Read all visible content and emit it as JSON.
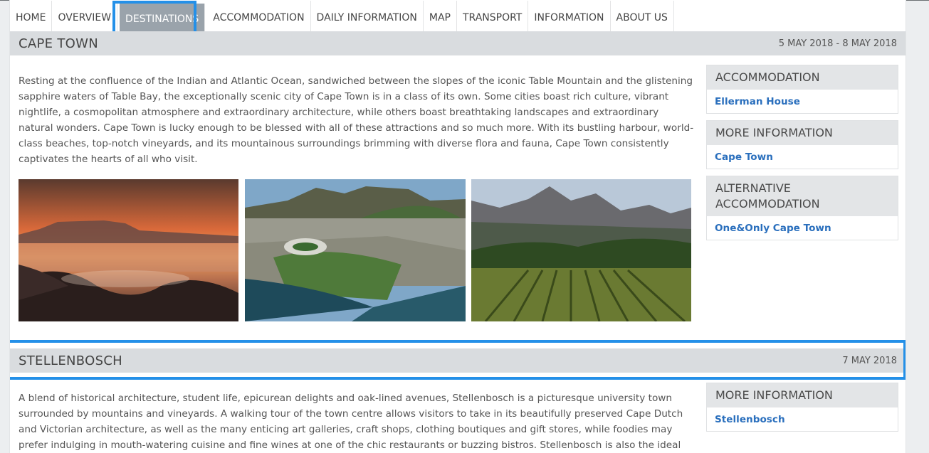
{
  "nav": {
    "items": [
      "HOME",
      "OVERVIEW",
      "DESTINATIONS",
      "ACCOMMODATION",
      "DAILY INFORMATION",
      "MAP",
      "TRANSPORT",
      "INFORMATION",
      "ABOUT US"
    ],
    "active": "DESTINATIONS"
  },
  "cape_town": {
    "title": "CAPE TOWN",
    "dates": "5 MAY 2018 - 8 MAY 2018",
    "description": "Resting at the confluence of the Indian and Atlantic Ocean, sandwiched between the slopes of the iconic Table Mountain and the glistening sapphire waters of Table Bay, the exceptionally scenic city of Cape Town is in a class of its own. Some cities boast rich culture, vibrant nightlife, a cosmopolitan atmosphere and extraordinary architecture, while others boast breathtaking landscapes and extraordinary natural wonders. Cape Town is lucky enough to be blessed with all of these attractions and so much more. With its bustling harbour, world-class beaches, top-notch vineyards, and its mountainous surroundings brimming with diverse flora and fauna, Cape Town consistently captivates the hearts of all who visit.",
    "sidebar": {
      "accommodation_heading": "ACCOMMODATION",
      "accommodation_link": "Ellerman House",
      "more_info_heading": "MORE INFORMATION",
      "more_info_link": "Cape Town",
      "alt_heading": "ALTERNATIVE ACCOMMODATION",
      "alt_link": "One&Only Cape Town"
    }
  },
  "stellenbosch": {
    "title": "STELLENBOSCH",
    "dates": "7 MAY 2018",
    "description": "A blend of historical architecture, student life, epicurean delights and oak-lined avenues, Stellenbosch is a picturesque university town surrounded by mountains and vineyards. A walking tour of the town centre allows visitors to take in its beautifully preserved Cape Dutch and Victorian architecture, as well as the many enticing art galleries, craft shops, clothing boutiques and gift stores, while foodies may prefer indulging in mouth-watering cuisine and fine wines at one of the chic restaurants or buzzing bistros. Stellenbosch is also the ideal base from",
    "sidebar": {
      "more_info_heading": "MORE INFORMATION",
      "more_info_link": "Stellenbosch"
    }
  },
  "colors": {
    "accent_outline": "#2490e8",
    "link": "#2a6fbd",
    "header_bg": "#d9dcdf",
    "active_nav_bg": "#9aa3ab"
  }
}
